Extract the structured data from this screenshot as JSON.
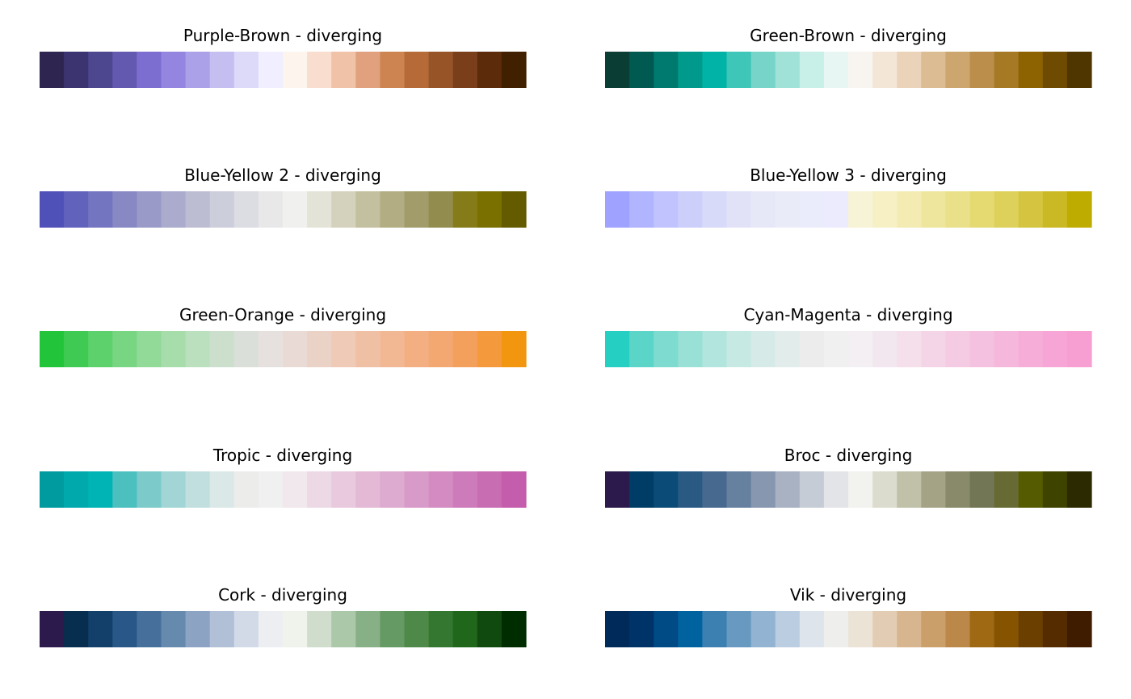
{
  "chart_data": {
    "type": "palette-swatches",
    "palettes": [
      {
        "title": "Purple-Brown - diverging",
        "colors": [
          "#2e2651",
          "#3b3470",
          "#4d4790",
          "#6459b0",
          "#7c6ed1",
          "#9486e0",
          "#aba1e8",
          "#c4bff0",
          "#dcdaf8",
          "#f0eeff",
          "#fdf4ee",
          "#f9ddcf",
          "#f0c2a8",
          "#e1a17f",
          "#cd8451",
          "#b56a37",
          "#965427",
          "#7a3e1b",
          "#5c2b0a",
          "#412000"
        ]
      },
      {
        "title": "Green-Brown - diverging",
        "colors": [
          "#0a3e35",
          "#005a52",
          "#00796e",
          "#009a8c",
          "#00b3a6",
          "#3ec6b8",
          "#76d5c8",
          "#a1e2d8",
          "#c8efe8",
          "#e8f6f3",
          "#f8f5f0",
          "#f4e6d6",
          "#ead3b8",
          "#dcbc93",
          "#cda56f",
          "#bb8e4b",
          "#a67a25",
          "#8d6200",
          "#6e4b00",
          "#4f3600"
        ]
      },
      {
        "title": "Blue-Yellow 2 - diverging",
        "colors": [
          "#5051b8",
          "#6062bc",
          "#7475c0",
          "#8788c4",
          "#999ac8",
          "#aaabcd",
          "#bcbdd2",
          "#cdcedb",
          "#dcdde2",
          "#e8e8e8",
          "#f0f0ee",
          "#e4e3d8",
          "#d4d2bc",
          "#c3c09f",
          "#b2ad83",
          "#a19c6a",
          "#928c4f",
          "#857c19",
          "#7a7000",
          "#645b00"
        ]
      },
      {
        "title": "Blue-Yellow 3 - diverging",
        "colors": [
          "#9fa3ff",
          "#b1b4ff",
          "#c0c3fd",
          "#cdcffb",
          "#d8daf9",
          "#e1e2f8",
          "#e7e8f7",
          "#eaebf8",
          "#ebecfb",
          "#ebebfd",
          "#f7f3d7",
          "#f6f0c4",
          "#f3ebb2",
          "#efe69d",
          "#eae089",
          "#e5d972",
          "#ddd05b",
          "#d4c43f",
          "#cbb825",
          "#bfac00"
        ]
      },
      {
        "title": "Green-Orange - diverging",
        "colors": [
          "#22c53a",
          "#3fcb53",
          "#5dd16b",
          "#78d683",
          "#91da98",
          "#a6ddab",
          "#bbe0bd",
          "#ccdfcc",
          "#dbdfd9",
          "#e6e1df",
          "#eadad6",
          "#ebd2c6",
          "#eecab7",
          "#f0c0a5",
          "#f2b894",
          "#f3af82",
          "#f3a871",
          "#f3a05c",
          "#f49a3d",
          "#f3960f"
        ]
      },
      {
        "title": "Cyan-Magenta - diverging",
        "colors": [
          "#25d0c2",
          "#5bd5c8",
          "#7ddbcf",
          "#99e0d6",
          "#b1e5dd",
          "#c6e9e3",
          "#d6ebe8",
          "#e2edeb",
          "#ececec",
          "#f0f0f0",
          "#f3eff2",
          "#f2e7ee",
          "#f4dfeb",
          "#f4d5e8",
          "#f5cbe3",
          "#f5c1e0",
          "#f6b7dc",
          "#f6aed9",
          "#f7a5d6",
          "#f79ed3"
        ]
      },
      {
        "title": "Tropic - diverging",
        "colors": [
          "#009b9f",
          "#00aaac",
          "#00b3b4",
          "#4cbfbf",
          "#7dcaca",
          "#a2d5d5",
          "#c2dfdf",
          "#dbe8e8",
          "#ececeb",
          "#f0f0f0",
          "#f0e8ed",
          "#edd8e5",
          "#e8c9de",
          "#e3b9d5",
          "#ddaad0",
          "#d89ac8",
          "#d38bc1",
          "#ce7bbb",
          "#c96db3",
          "#c45dac"
        ]
      },
      {
        "title": "Broc - diverging",
        "colors": [
          "#2c1a4c",
          "#003d66",
          "#0a4c77",
          "#2a5a83",
          "#48698f",
          "#66809f",
          "#8797b0",
          "#a8b2c3",
          "#c6ccd6",
          "#e2e4e8",
          "#f2f2ef",
          "#dcdcce",
          "#c1c1a9",
          "#a5a386",
          "#898a6a",
          "#737654",
          "#676a32",
          "#555b01",
          "#3e4300",
          "#2b2a00"
        ]
      },
      {
        "title": "Cork - diverging",
        "colors": [
          "#2c1a4c",
          "#082e4f",
          "#12406a",
          "#295787",
          "#46709b",
          "#6689ae",
          "#8ca3c3",
          "#b1c0d7",
          "#d2dae8",
          "#eceef2",
          "#f0f2ec",
          "#d0ddcc",
          "#abc8a8",
          "#88b087",
          "#669a65",
          "#4f8949",
          "#337730",
          "#20661b",
          "#104a0e",
          "#002d00"
        ]
      },
      {
        "title": "Vik - diverging",
        "colors": [
          "#002a5a",
          "#003469",
          "#004a85",
          "#0063a0",
          "#3c7fb1",
          "#6899c1",
          "#92b3d2",
          "#bbcde0",
          "#dde4ec",
          "#eeeeed",
          "#ece3d7",
          "#e2cdb4",
          "#d7b58f",
          "#ca9f6a",
          "#bc884a",
          "#9f6813",
          "#865400",
          "#6b3f00",
          "#542c00",
          "#3f1c00"
        ]
      }
    ]
  }
}
